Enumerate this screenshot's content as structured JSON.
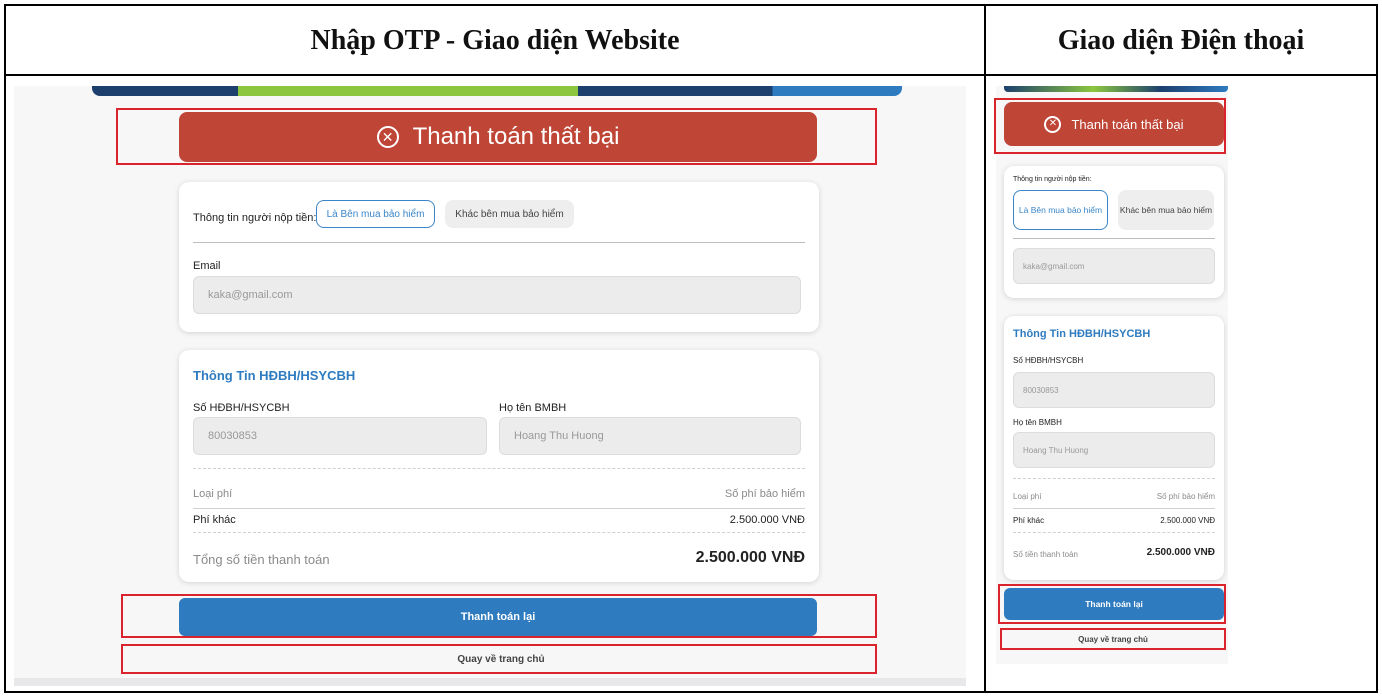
{
  "header": {
    "left_title": "Nhập OTP - Giao diện Website",
    "right_title": "Giao diện Điện thoại"
  },
  "status": {
    "icon": "x-circle-icon",
    "text": "Thanh toán thất bại",
    "color": "#bf4536"
  },
  "payer": {
    "label": "Thông tin người nộp tiền:",
    "option_self": "Là Bên mua bảo hiểm",
    "option_other": "Khác bên mua bảo hiểm",
    "email_label": "Email",
    "email_value": "kaka@gmail.com"
  },
  "policy": {
    "section_title": "Thông Tin HĐBH/HSYCBH",
    "policy_no_label": "Số HĐBH/HSYCBH",
    "policy_no_value": "80030853",
    "name_label": "Họ tên BMBH",
    "name_value": "Hoang Thu Huong",
    "fee_type_header": "Loại phí",
    "fee_amount_header": "Số phí bảo hiểm",
    "fee_type": "Phí khác",
    "fee_amount": "2.500.000 VNĐ",
    "total_label_web": "Tổng số tiền thanh toán",
    "total_label_mobile": "Số tiền thanh toán",
    "total_value": "2.500.000 VNĐ"
  },
  "actions": {
    "retry": "Thanh toán lại",
    "home": "Quay về trang chủ"
  },
  "colors": {
    "accent": "#2e7bc0",
    "highlight": "#d9232d"
  }
}
